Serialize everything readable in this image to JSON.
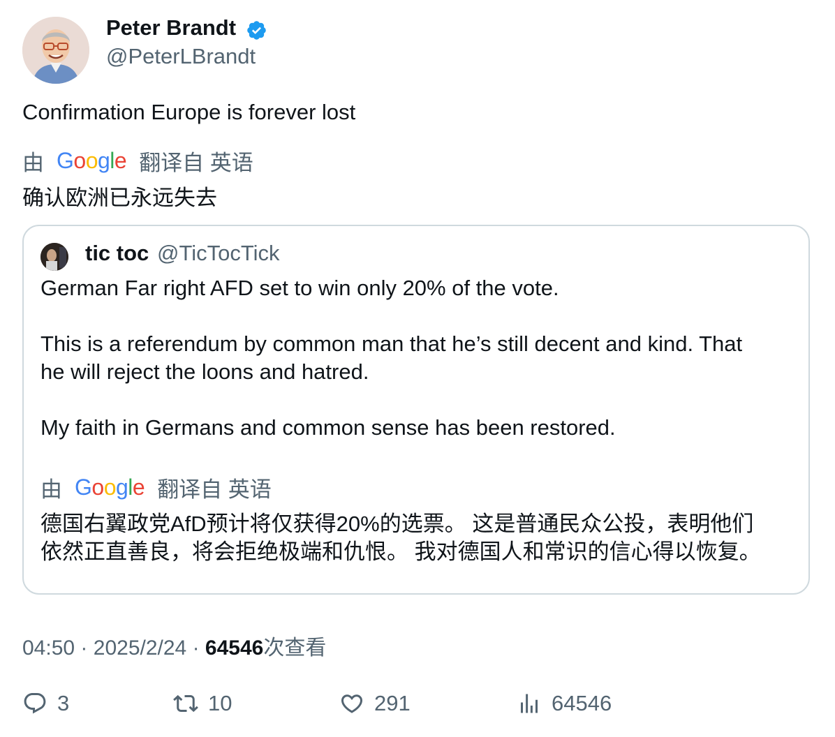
{
  "author": {
    "name": "Peter Brandt",
    "handle": "@PeterLBrandt",
    "verified_color": "#1d9bf0"
  },
  "tweet": {
    "text": "Confirmation Europe is forever lost",
    "translation": {
      "by": "由",
      "provider": "Google",
      "translated_from": "翻译自 英语",
      "text": "确认欧洲已永远失去"
    }
  },
  "quoted": {
    "name": "tic toc",
    "handle": "@TicTocTick",
    "lines": [
      "German Far right AFD set to win only 20% of the vote.",
      "This is a referendum by common man that he’s still decent and kind. That",
      "he will reject the loons and hatred.",
      "My faith in Germans and common sense has been restored."
    ],
    "translation": {
      "by": "由",
      "provider": "Google",
      "translated_from": "翻译自 英语",
      "lines": [
        "德国右翼政党AfD预计将仅获得20%的选票。 这是普通民众公投，表明他们",
        "依然正直善良，将会拒绝极端和仇恨。 我对德国人和常识的信心得以恢复。"
      ]
    }
  },
  "meta": {
    "time": "04:50",
    "separator": "·",
    "date": "2025/2/24",
    "views": "64546",
    "views_label": "次查看"
  },
  "actions": {
    "replies": "3",
    "reposts": "10",
    "likes": "291",
    "views": "64546",
    "icon_names": [
      "reply-icon",
      "repost-icon",
      "like-icon",
      "views-icon"
    ]
  }
}
